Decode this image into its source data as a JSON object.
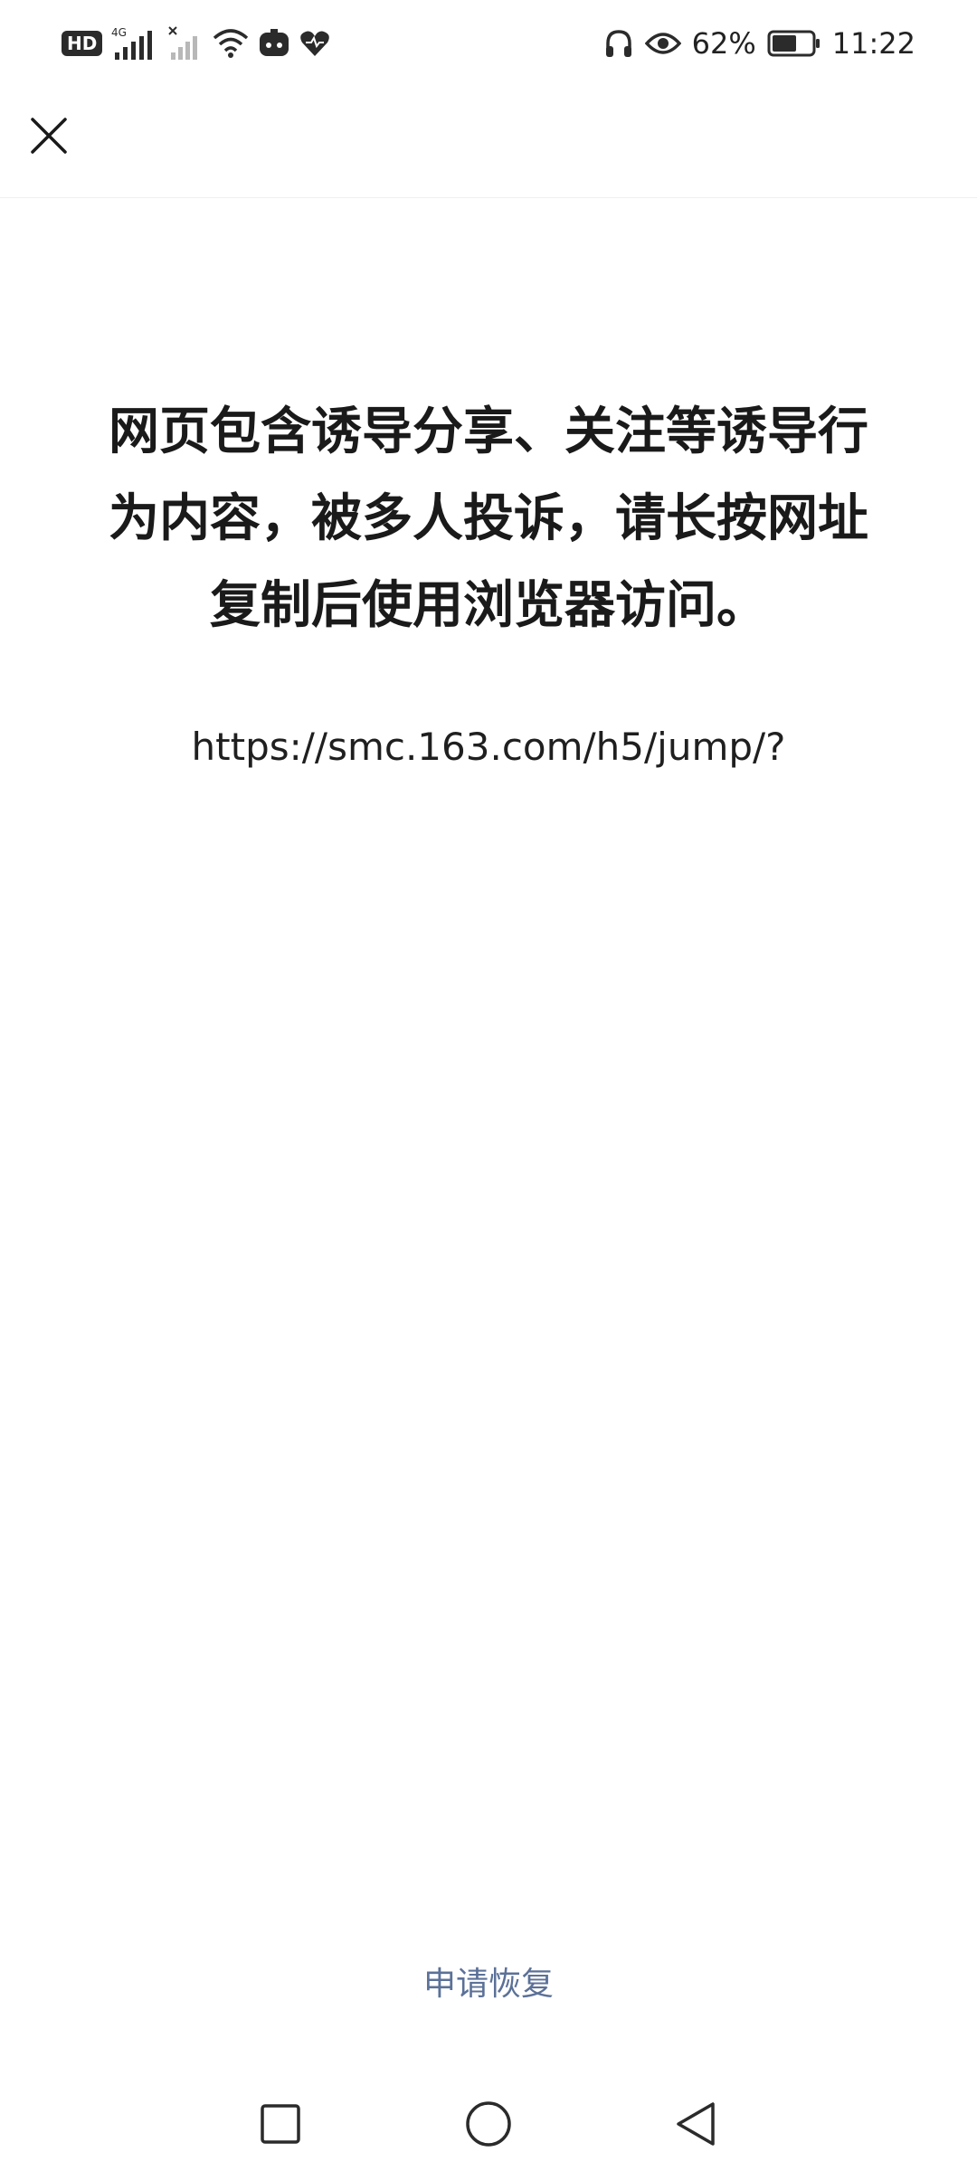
{
  "status_bar": {
    "hd_label": "HD",
    "network_label": "4G",
    "battery_percent": "62%",
    "time": "11:22",
    "icons": [
      "hd-icon",
      "signal-4g-icon",
      "signal-no-sim-icon",
      "wifi-icon",
      "game-icon",
      "health-heart-icon",
      "headphones-icon",
      "eye-comfort-icon",
      "battery-icon"
    ]
  },
  "top_bar": {
    "close_icon": "close-icon"
  },
  "message": {
    "text": "网页包含诱导分享、关注等诱导行\n为内容，被多人投诉，请长按网址\n复制后使用浏览器访问。",
    "url": "https://smc.163.com/h5/jump/?"
  },
  "footer": {
    "appeal_label": "申请恢复",
    "appeal_color": "#5c7198"
  },
  "nav_bar": {
    "icons": [
      "recent-apps-icon",
      "home-icon",
      "back-icon"
    ]
  }
}
